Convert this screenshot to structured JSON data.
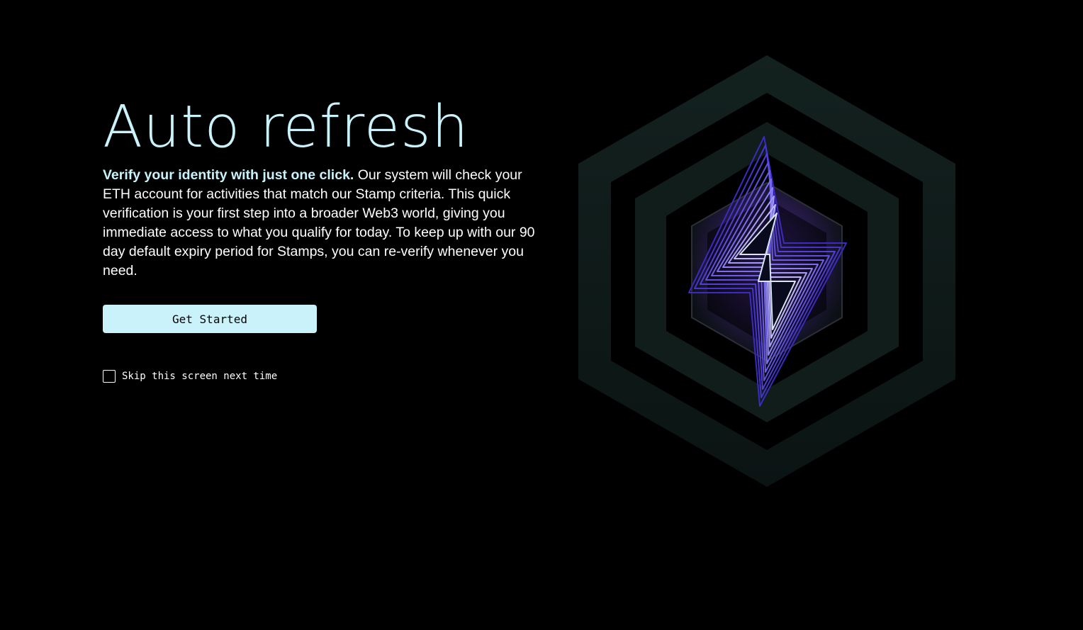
{
  "page": {
    "title": "Auto refresh",
    "description_lead": "Verify your identity with just one click.",
    "description_body": " Our system will check your ETH account for activities that match our Stamp criteria. This quick verification is your first step into a broader Web3 world, giving you immediate access to what you qualify for today. To keep up with our 90 day default expiry period for Stamps, you can re-verify whenever you need.",
    "cta_label": "Get Started",
    "skip_label": "Skip this screen next time",
    "skip_checked": false
  },
  "illustration": {
    "icon": "lightning-hexagon-icon"
  },
  "colors": {
    "background": "#000000",
    "accent": "#c9f2fb",
    "body_text": "#ffffff",
    "hex_ring": "#0f1d1b",
    "glow": "#5a3ca8",
    "bolt_outline": "#6a4cff"
  }
}
